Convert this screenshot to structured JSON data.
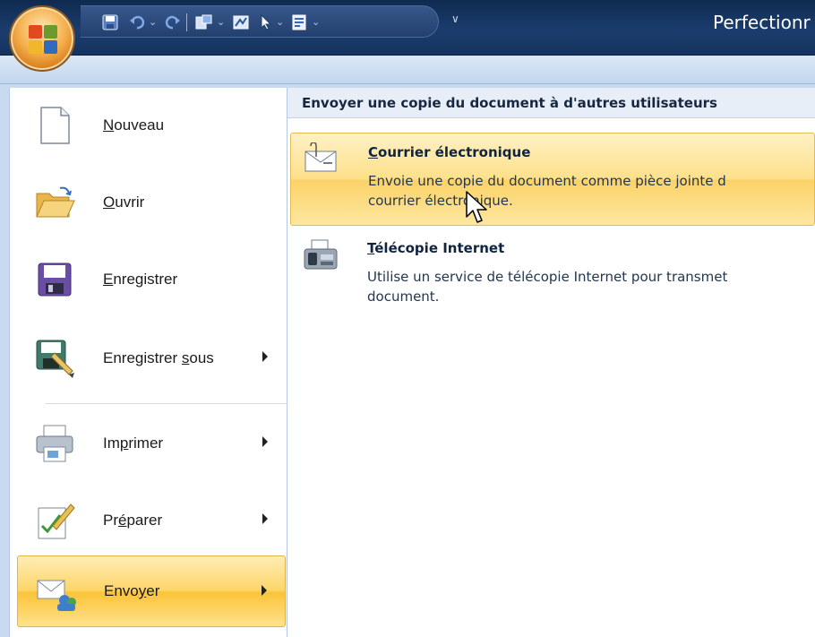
{
  "window": {
    "title": "Perfectionr"
  },
  "quick_access_toolbar": {
    "customize_glyph": "∨",
    "dropdown_glyph": "⌄"
  },
  "office_button": {
    "icon": "office-logo-icon"
  },
  "menu": {
    "items": [
      {
        "id": "nouveau",
        "label_u": "N",
        "label_rest": "ouveau",
        "icon": "new-document-icon",
        "has_submenu": false
      },
      {
        "id": "ouvrir",
        "label_u": "O",
        "label_rest": "uvrir",
        "icon": "open-folder-icon",
        "has_submenu": false
      },
      {
        "id": "enregistrer",
        "label_u": "E",
        "label_rest": "nregistrer",
        "icon": "save-icon",
        "has_submenu": false
      },
      {
        "id": "enregistrer-sous",
        "label_pre": "Enregistrer ",
        "label_u": "s",
        "label_rest": "ous",
        "icon": "save-as-icon",
        "has_submenu": true
      },
      {
        "id": "imprimer",
        "label_pre": "Im",
        "label_u": "p",
        "label_rest": "rimer",
        "icon": "printer-icon",
        "has_submenu": true
      },
      {
        "id": "preparer",
        "label_pre": "Pr",
        "label_u": "é",
        "label_rest": "parer",
        "icon": "prepare-icon",
        "has_submenu": true
      },
      {
        "id": "envoyer",
        "label_pre": "Envo",
        "label_u": "y",
        "label_rest": "er",
        "icon": "send-icon",
        "has_submenu": true,
        "selected": true
      }
    ]
  },
  "submenu": {
    "header": "Envoyer une copie du document à d'autres utilisateurs",
    "options": [
      {
        "title_u": "C",
        "title_rest": "ourrier électronique",
        "desc_line1": "Envoie une copie du document comme pièce jointe d",
        "desc_line2": "courrier électronique.",
        "icon": "email-envelope-icon",
        "hover": true
      },
      {
        "title_u": "T",
        "title_rest": "élécopie Internet",
        "desc_line1": "Utilise un service de télécopie Internet pour transmet",
        "desc_line2": "document.",
        "icon": "fax-machine-icon",
        "hover": false
      }
    ]
  },
  "colors": {
    "title_bar": "#1b3d6e",
    "menu_selected": "#fbc439",
    "menu_background": "#c9daf0"
  }
}
